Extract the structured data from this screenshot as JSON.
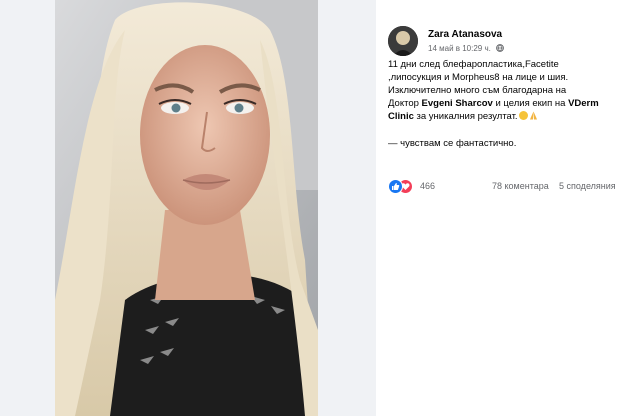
{
  "post": {
    "author": "Zara Atanasova",
    "timestamp": "14 май в 10:29 ч.",
    "visibility_icon": "globe-icon",
    "text_lines": [
      "11 дни след блефаропластика,Facetite",
      ",липосукция и Morpheus8 на лице и шия.",
      "Изключително много съм благодарна на"
    ],
    "line4_pre": "Доктор ",
    "line4_bold": "Evgeni Sharcov",
    "line4_post": " и целия екип на ",
    "line4_bold2": "VDerm",
    "line5_bold": "Clinic",
    "line5_post": " за уникалния резултат.",
    "feeling": "— чувствам се фантастично."
  },
  "reactions": {
    "icons": [
      "like-icon",
      "love-icon"
    ],
    "count": "466",
    "comments": "78 коментара",
    "shares": "5 споделяния"
  },
  "colors": {
    "like": "#1877f2",
    "love": "#f33e58",
    "secondary_text": "#65676b"
  }
}
